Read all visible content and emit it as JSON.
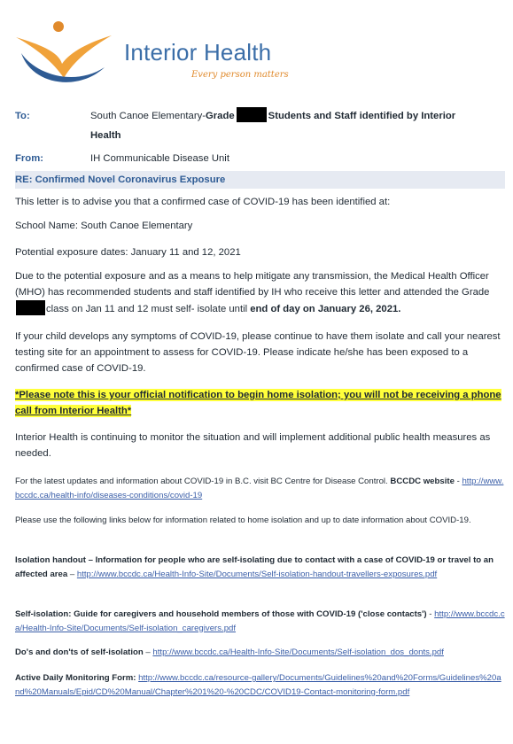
{
  "logo": {
    "name": "Interior Health",
    "tagline": "Every person matters",
    "colors": {
      "blue": "#3b6ea8",
      "orange": "#e08a2c",
      "navy": "#2e5b94"
    }
  },
  "header": {
    "to_label": "To:",
    "to_text_1": "South Canoe Elementary-",
    "to_bold_1": "Grade",
    "to_bold_2": "Students and Staff identified by Interior",
    "to_bold_3": "Health",
    "from_label": "From:",
    "from_value": "IH Communicable Disease Unit",
    "re": "RE: Confirmed Novel Coronavirus Exposure"
  },
  "body": {
    "p1": "This letter is to advise you that a confirmed case of COVID-19 has been identified at:",
    "p2": "School Name: South Canoe Elementary",
    "p3": "Potential exposure dates: January 11 and 12, 2021",
    "p4_a": "Due to the potential exposure and as a means to help mitigate any transmission, the Medical Health Officer (MHO) has recommended students and staff identified by IH who receive this letter and attended the Grade",
    "p4_b": "class on Jan 11 and 12 must self- isolate until",
    "p4_bold": "end of day on January 26, 2021.",
    "p5": "If your child develops any symptoms of COVID-19, please continue to have them isolate and call your nearest testing site for an appointment to assess for COVID-19. Please indicate he/she has been exposed to a confirmed case of COVID-19.",
    "highlight": "*Please note this is your official notification to begin home isolation; you will not be receiving a phone call from Interior Health*",
    "p6": "Interior Health is continuing to monitor the situation and will implement additional public health measures as needed.",
    "p7_text": "For the latest updates and information about COVID-19 in B.C. visit BC Centre for Disease Control.",
    "p7_bold": "BCCDC website",
    "p7_dash": " -",
    "p7_link": "http://www.bccdc.ca/health-info/diseases-conditions/covid-19",
    "p8": "Please use the following links below for information related to home isolation and up to date information about COVID-19.",
    "iso_bold": "Isolation handout – Information for people who are self-isolating due to contact with a case of COVID-19 or travel to an affected area",
    "iso_dash": " – ",
    "iso_link": "http://www.bccdc.ca/Health-Info-Site/Documents/Self-isolation-handout-travellers-exposures.pdf",
    "self_bold": "Self-isolation: Guide for caregivers and household members of those with COVID-19 ('close contacts')",
    "self_dash": " -",
    "self_link": "http://www.bccdc.ca/Health-Info-Site/Documents/Self-isolation_caregivers.pdf",
    "dos_bold": "Do's and don'ts of self-isolation",
    "dos_dash": " – ",
    "dos_link": "http://www.bccdc.ca/Health-Info-Site/Documents/Self-isolation_dos_donts.pdf",
    "adm_bold": "Active Daily Monitoring Form:",
    "adm_link": "http://www.bccdc.ca/resource-gallery/Documents/Guidelines%20and%20Forms/Guidelines%20and%20Manuals/Epid/CD%20Manual/Chapter%201%20-%20CDC/COVID19-Contact-monitoring-form.pdf"
  }
}
